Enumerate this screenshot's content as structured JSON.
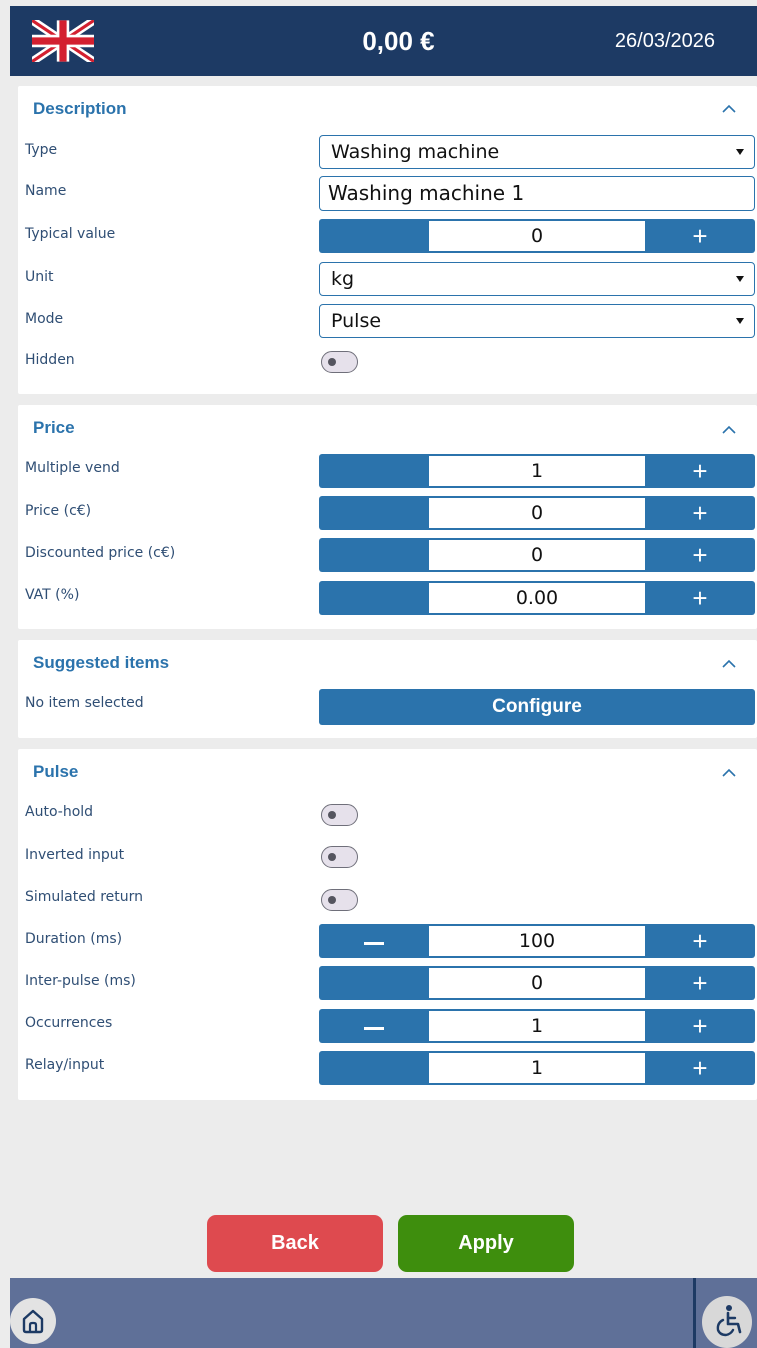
{
  "header": {
    "flag_icon": "uk-flag-icon",
    "balance": "0,00 €",
    "date": "26/03/2026"
  },
  "description": {
    "title": "Description",
    "type_label": "Type",
    "type_value": "Washing machine",
    "name_label": "Name",
    "name_value": "Washing machine 1",
    "typical_label": "Typical value",
    "typical_value": "0",
    "unit_label": "Unit",
    "unit_value": "kg",
    "mode_label": "Mode",
    "mode_value": "Pulse",
    "hidden_label": "Hidden"
  },
  "price": {
    "title": "Price",
    "multiple_vend_label": "Multiple vend",
    "multiple_vend_value": "1",
    "price_label": "Price (c€)",
    "price_value": "0",
    "discounted_label": "Discounted price (c€)",
    "discounted_value": "0",
    "vat_label": "VAT (%)",
    "vat_value": "0.00"
  },
  "suggested": {
    "title": "Suggested items",
    "status": "No item selected",
    "configure_label": "Configure"
  },
  "pulse": {
    "title": "Pulse",
    "autohold_label": "Auto-hold",
    "inverted_label": "Inverted input",
    "simulated_label": "Simulated return",
    "duration_label": "Duration (ms)",
    "duration_value": "100",
    "interpulse_label": "Inter-pulse (ms)",
    "interpulse_value": "0",
    "occurrences_label": "Occurrences",
    "occurrences_value": "1",
    "relay_label": "Relay/input",
    "relay_value": "1"
  },
  "footer": {
    "back_label": "Back",
    "apply_label": "Apply"
  },
  "colors": {
    "header_bg": "#1d3a64",
    "accent": "#2b73ac",
    "back": "#de4a4f",
    "apply": "#3e8e0d",
    "bottom_bar": "#5f7098"
  }
}
